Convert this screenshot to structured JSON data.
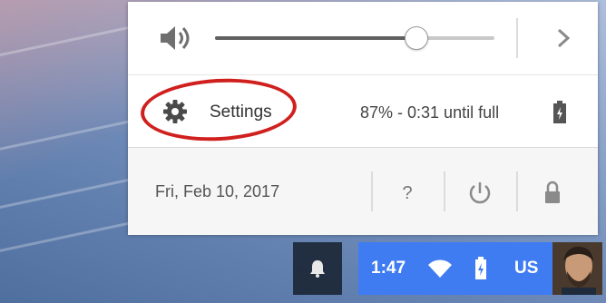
{
  "volume": {
    "level_percent": 72,
    "icons": {
      "speaker": "speaker-icon",
      "expand": "chevron-right-icon"
    }
  },
  "settings": {
    "label": "Settings",
    "icon": "gear-icon",
    "annotation_color": "#d0201e"
  },
  "battery": {
    "status_text": "87% - 0:31 until full",
    "icon": "battery-charging-icon"
  },
  "footer": {
    "date": "Fri, Feb 10, 2017",
    "help_label": "?",
    "icons": {
      "power": "power-icon",
      "lock": "lock-icon"
    }
  },
  "shelf": {
    "notification_icon": "bell-icon",
    "time": "1:47",
    "wifi_icon": "wifi-icon",
    "battery_icon": "battery-charging-icon",
    "input_language": "US",
    "tray_color": "#3f7cf2"
  }
}
